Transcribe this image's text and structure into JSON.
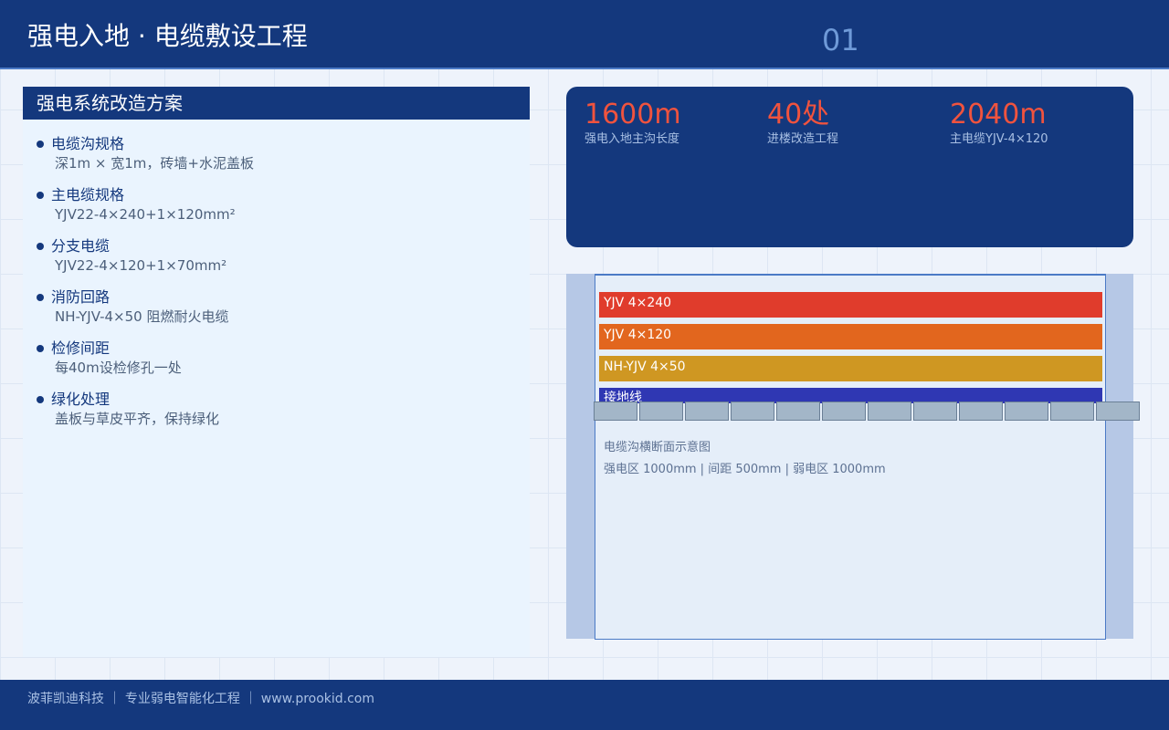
{
  "header": {
    "title": "强电入地 · 电缆敷设工程",
    "page_no": "01"
  },
  "left_panel": {
    "title": "强电系统改造方案",
    "items": [
      {
        "label": "电缆沟规格",
        "value": "深1m × 宽1m，砖墙+水泥盖板"
      },
      {
        "label": "主电缆规格",
        "value": "YJV22-4×240+1×120mm²"
      },
      {
        "label": "分支电缆",
        "value": "YJV22-4×120+1×70mm²"
      },
      {
        "label": "消防回路",
        "value": "NH-YJV-4×50 阻燃耐火电缆"
      },
      {
        "label": "检修间距",
        "value": "每40m设检修孔一处"
      },
      {
        "label": "绿化处理",
        "value": "盖板与草皮平齐，保持绿化"
      }
    ]
  },
  "stats": [
    {
      "value": "1600m",
      "caption": "强电入地主沟长度"
    },
    {
      "value": "40处",
      "caption": "进楼改造工程"
    },
    {
      "value": "2040m",
      "caption": "主电缆YJV-4×120"
    }
  ],
  "diagram": {
    "cables": [
      {
        "label": "YJV 4×240",
        "color": "#e03c2c"
      },
      {
        "label": "YJV 4×120",
        "color": "#e2661e"
      },
      {
        "label": "NH-YJV 4×50",
        "color": "#cf9722"
      },
      {
        "label": "接地线",
        "color": "#2f37b3"
      }
    ],
    "cover_color": "#a3b6c8",
    "caption": "电缆沟横断面示意图",
    "dimensions": "强电区 1000mm | 间距 500mm | 弱电区 1000mm"
  },
  "footer": {
    "text": "波菲凯迪科技 ｜ 专业弱电智能化工程 ｜ www.prookid.com"
  },
  "colors": {
    "primary": "#14387d",
    "accent": "#f0533e",
    "panel": "#eaf4fe"
  }
}
